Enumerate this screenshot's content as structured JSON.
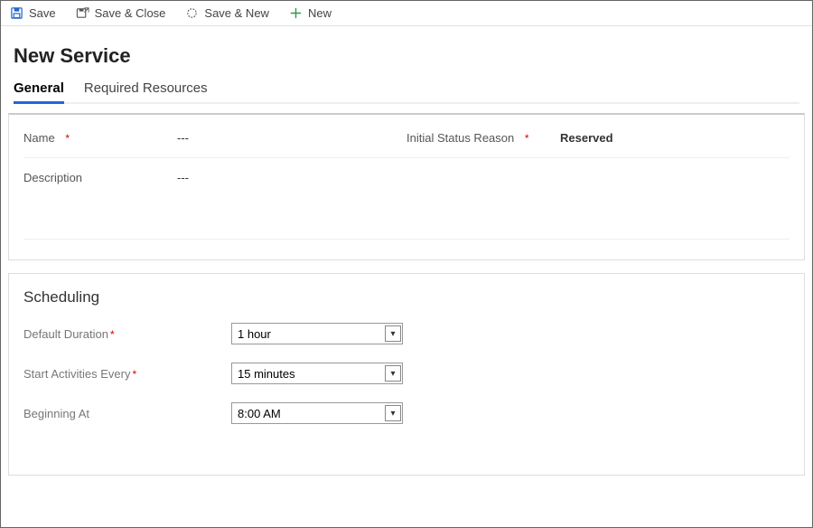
{
  "toolbar": {
    "save": "Save",
    "save_close": "Save & Close",
    "save_new": "Save & New",
    "new": "New"
  },
  "page_title": "New Service",
  "tabs": {
    "general": "General",
    "required_resources": "Required Resources"
  },
  "form": {
    "name_label": "Name",
    "name_value": "---",
    "description_label": "Description",
    "description_value": "---",
    "status_label": "Initial Status Reason",
    "status_value": "Reserved"
  },
  "scheduling": {
    "title": "Scheduling",
    "default_duration_label": "Default Duration",
    "default_duration_value": "1 hour",
    "start_every_label": "Start Activities Every",
    "start_every_value": "15 minutes",
    "beginning_at_label": "Beginning At",
    "beginning_at_value": "8:00 AM"
  }
}
